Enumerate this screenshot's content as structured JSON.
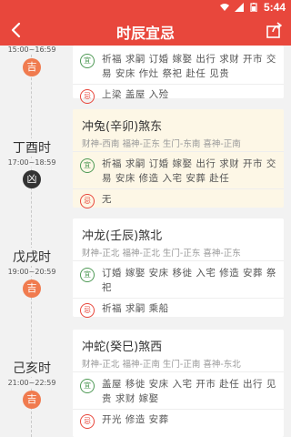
{
  "status": {
    "time": "5:44"
  },
  "appbar": {
    "title": "时辰宜忌"
  },
  "badges": {
    "yi": "宜",
    "ji": "忌"
  },
  "entries": [
    {
      "slot": {
        "name": "",
        "range": "15:00~16:59",
        "luck": "吉"
      },
      "card": {
        "head": "",
        "gods": "",
        "yi": "祈福 求嗣 订婚 嫁娶 出行 求财 开市 交易 安床 作灶 祭祀 赴任 见贵",
        "ji": "上梁 盖屋 入殓"
      }
    },
    {
      "slot": {
        "name": "丁酉时",
        "range": "17:00~18:59",
        "luck": "凶"
      },
      "card": {
        "head": "冲兔(辛卯)煞东",
        "gods": "财神-西南 福神-正东 生门-东南 喜神-正南",
        "yi": "祈福 求嗣 订婚 嫁娶 出行 求财 开市 交易 安床 修造 入宅 安葬 赴任",
        "ji": "无"
      }
    },
    {
      "slot": {
        "name": "戊戌时",
        "range": "19:00~20:59",
        "luck": "吉"
      },
      "card": {
        "head": "冲龙(壬辰)煞北",
        "gods": "财神-正北 福神-正北 生门-正东 喜神-正东",
        "yi": "订婚 嫁娶 安床 移徙 入宅 修造 安葬 祭祀",
        "ji": "祈福 求嗣 乘船"
      }
    },
    {
      "slot": {
        "name": "己亥时",
        "range": "21:00~22:59",
        "luck": "吉"
      },
      "card": {
        "head": "冲蛇(癸巳)煞西",
        "gods": "财神-正北 福神-正南 生门-正南 喜神-东北",
        "yi": "盖屋 移徙 安床 入宅 开市 赴任 出行 见贵 求财 嫁娶",
        "ji": "开光 修造 安葬"
      }
    }
  ]
}
